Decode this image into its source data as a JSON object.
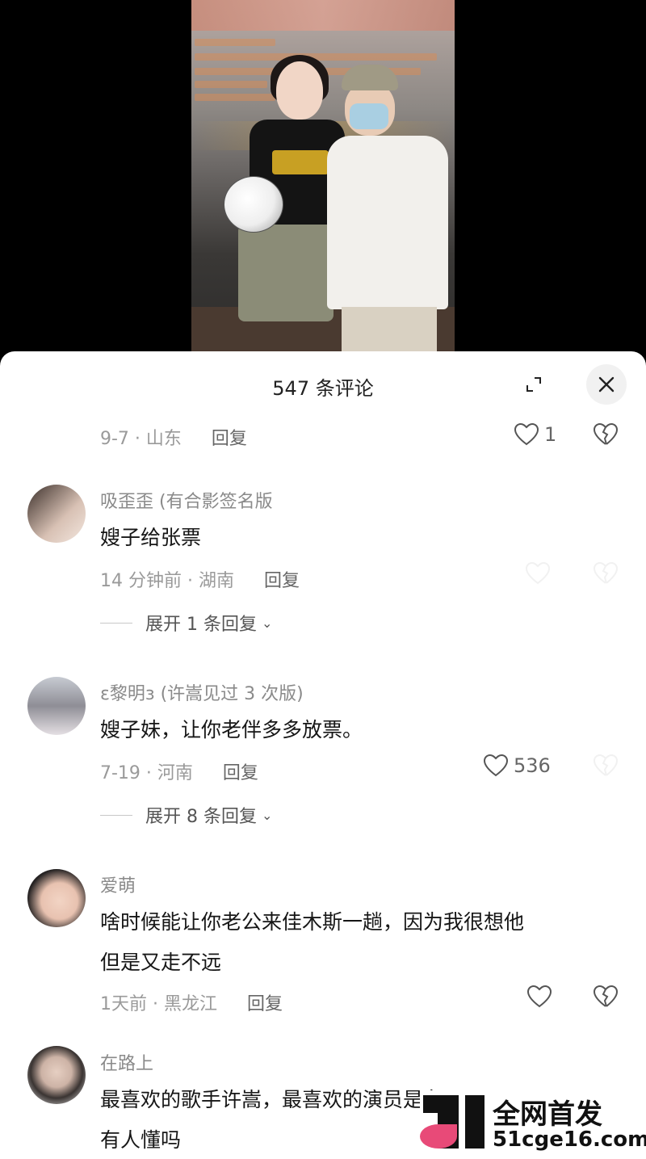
{
  "sheet": {
    "title": "547 条评论",
    "expand_icon": "expand-icon",
    "close_icon": "close-icon"
  },
  "comments": [
    {
      "meta_date": "9-7 · 山东",
      "reply_label": "回复",
      "likes": "1"
    },
    {
      "nickname": "吸歪歪 (有合影签名版",
      "text": "嫂子给张票",
      "meta_date": "14 分钟前 · 湖南",
      "reply_label": "回复",
      "expand_label": "展开 1 条回复"
    },
    {
      "nickname": "ε黎明з (许嵩见过 3 次版)",
      "text": "嫂子妹，让你老伴多多放票。",
      "meta_date": "7-19 · 河南",
      "reply_label": "回复",
      "likes": "536",
      "expand_label": "展开 8 条回复"
    },
    {
      "nickname": "爱萌",
      "text_line1": "啥时候能让你老公来佳木斯一趟，因为我很想他",
      "text_line2": "但是又走不远",
      "meta_date": "1天前 · 黑龙江",
      "reply_label": "回复"
    },
    {
      "nickname": "在路上",
      "text_line1": "最喜欢的歌手许嵩，最喜欢的演员是冬",
      "text_line2": "有人懂吗"
    }
  ],
  "watermark": {
    "title": "全网首发",
    "url": "51cge16.com"
  },
  "colors": {
    "sheet_bg": "#ffffff",
    "text_primary": "#161616",
    "text_secondary": "#9a9a9a",
    "accent_pink": "#e84a78"
  }
}
